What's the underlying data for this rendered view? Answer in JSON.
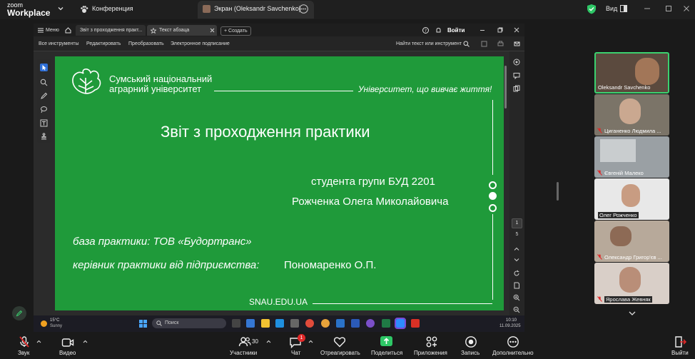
{
  "app": {
    "brand_line1": "zoom",
    "brand_line2": "Workplace",
    "conference_label": "Конференция",
    "screen_share_tab": "Экран (Oleksandr Savchenko)",
    "view_label": "Вид"
  },
  "pdf_viewer": {
    "menu_label": "Меню",
    "tab1": "Звіт з проходження практ...",
    "tab2": "Текст абзаца",
    "create_label": "+ Создать",
    "signin_label": "Войти",
    "toolbar_items": [
      "Все инструменты",
      "Редактировать",
      "Преобразовать",
      "Электронное подписание"
    ],
    "search_label": "Найти текст или инструмент",
    "page_current": "1",
    "page_total": "5"
  },
  "slide": {
    "university_line1": "Сумський національний",
    "university_line2": "аграрний університет",
    "motto": "Університет, що вивчає життя!",
    "title": "Звіт з проходження практики",
    "student_line1": "студента групи БУД 2201",
    "student_line2": "Рожченка Олега Миколайовича",
    "base_line": "база практики: ТОВ «Будортранс»",
    "supervisor_label": "керівник практики від підприємства:",
    "supervisor_name": "Пономаренко О.П.",
    "site": "SNAU.EDU.UA"
  },
  "windows_taskbar": {
    "temperature": "15°C",
    "weather": "Sunny",
    "search_label": "Поиск",
    "time": "10:10",
    "date": "11.09.2025"
  },
  "participants": [
    {
      "name": "Oleksandr Savchenko",
      "muted": false,
      "active": true
    },
    {
      "name": "Циганенко Людмила ...",
      "muted": true,
      "active": false
    },
    {
      "name": "Євгеній Малеко",
      "muted": true,
      "active": false
    },
    {
      "name": "Олег Рожченко",
      "muted": false,
      "active": false
    },
    {
      "name": "Олександр Григор'єв ...",
      "muted": true,
      "active": false
    },
    {
      "name": "Ярослава Жевняк",
      "muted": true,
      "active": false
    }
  ],
  "bottom_bar": {
    "audio": "Звук",
    "video": "Видео",
    "participants": "Участники",
    "participants_count": "30",
    "chat": "Чат",
    "chat_badge": "1",
    "react": "Отреагировать",
    "share": "Поделиться",
    "apps": "Приложения",
    "record": "Запись",
    "more": "Дополнительно",
    "leave": "Выйти"
  },
  "colors": {
    "slide_green": "#1f9a3a",
    "share_green": "#2ec766",
    "leave_red": "#e02828",
    "active_speaker": "#3bd16f"
  }
}
